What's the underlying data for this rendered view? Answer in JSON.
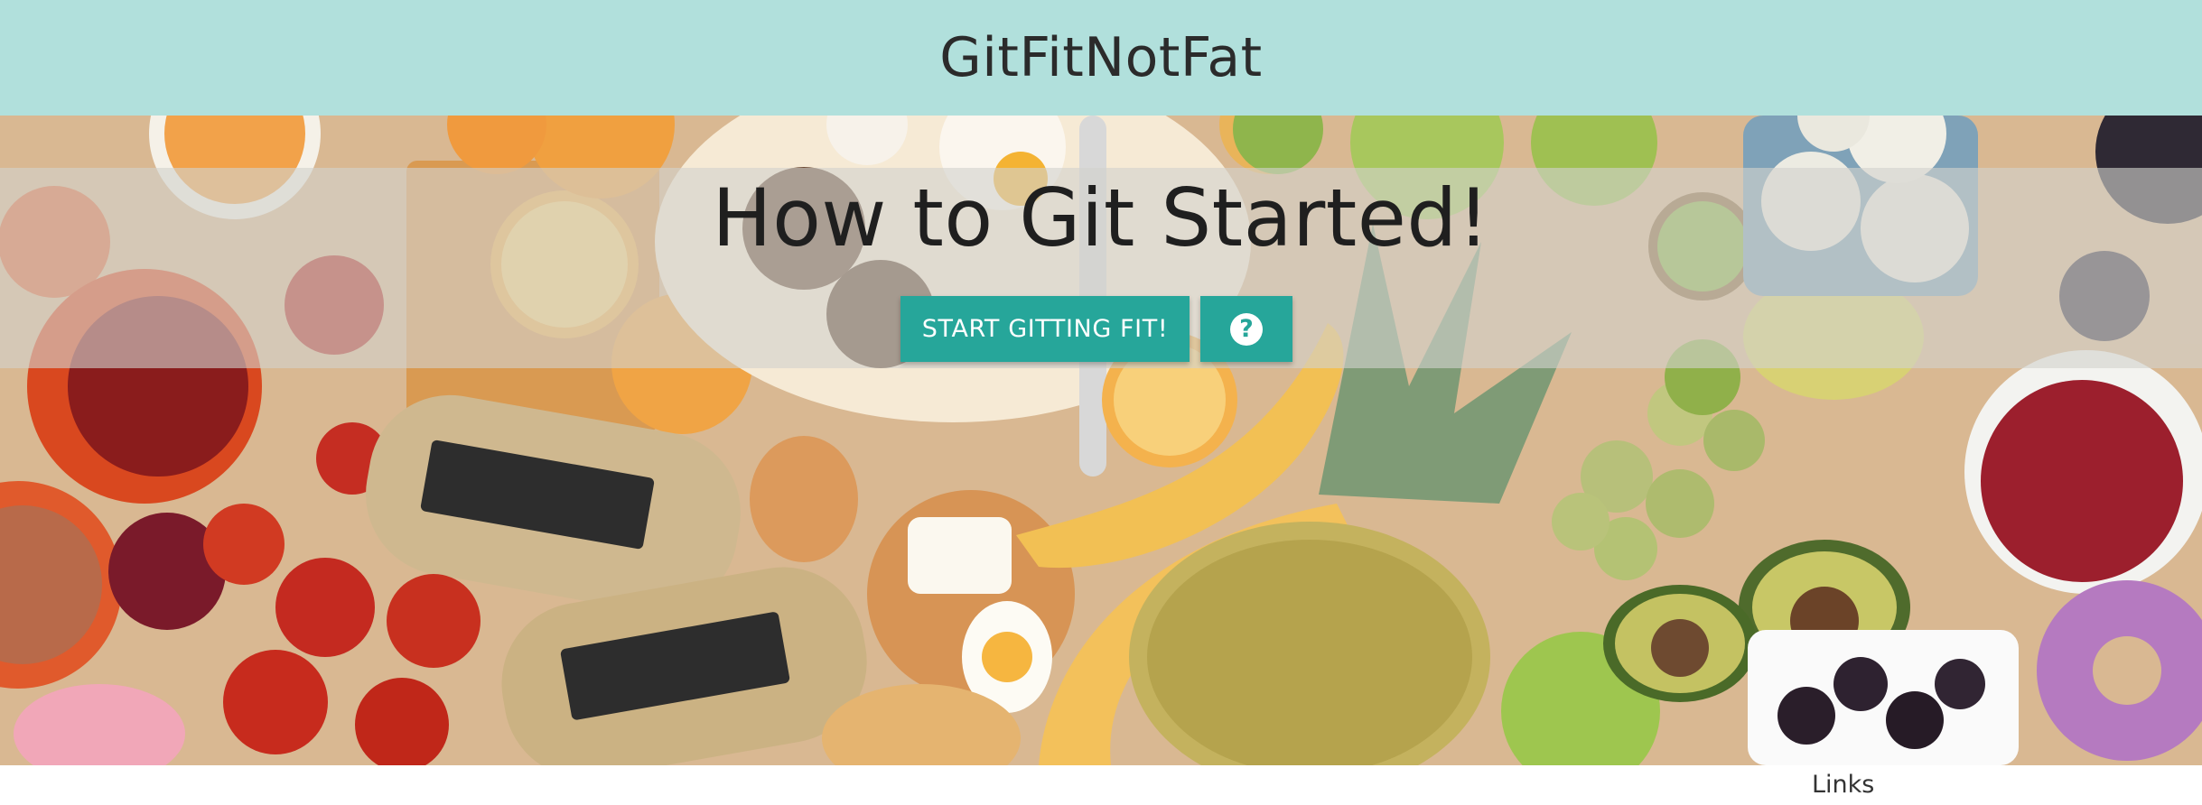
{
  "header": {
    "brand": "GitFitNotFat"
  },
  "hero": {
    "title": "How to Git Started!",
    "start_button_label": "START GITTING FIT!",
    "help_icon": "help-circle-icon",
    "background_image": "breakfast-food-spread"
  },
  "footer": {
    "links_heading": "Links"
  },
  "colors": {
    "navbar": "#b1e0dc",
    "accent": "#26a69a"
  }
}
